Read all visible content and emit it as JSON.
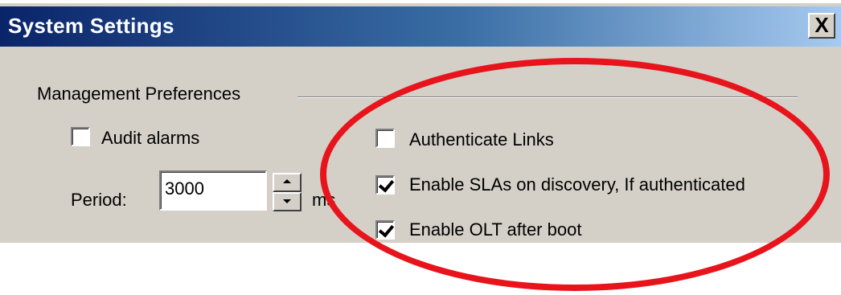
{
  "window": {
    "title": "System Settings",
    "close_label": "X"
  },
  "group": {
    "title": "Management Preferences"
  },
  "audit_alarms": {
    "label": "Audit alarms",
    "checked": false
  },
  "period": {
    "label": "Period:",
    "value": "3000",
    "unit": "ms"
  },
  "options": [
    {
      "label": "Authenticate Links",
      "checked": false
    },
    {
      "label": "Enable SLAs on discovery, If authenticated",
      "checked": true
    },
    {
      "label": "Enable OLT after boot",
      "checked": true
    }
  ],
  "colors": {
    "dialog_bg": "#d4d0c8",
    "title_gradient_start": "#0a246a",
    "title_gradient_end": "#a6caf0",
    "annotation": "#e8141b"
  },
  "icons": {
    "spinner_up": "spinner-up-icon",
    "spinner_down": "spinner-down-icon",
    "checkmark": "checkmark-icon"
  }
}
